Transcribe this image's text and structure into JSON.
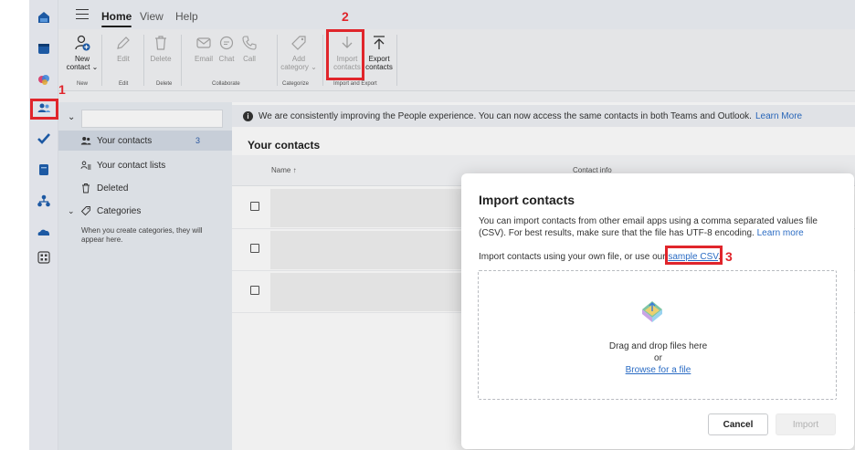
{
  "menu": {
    "tabs": [
      "Home",
      "View",
      "Help"
    ],
    "active": "Home"
  },
  "ribbon": {
    "buttons": [
      {
        "label1": "New",
        "label2": "contact ⌄",
        "icon": "person-add-icon"
      },
      {
        "label1": "Edit",
        "label2": "",
        "icon": "pencil-icon"
      },
      {
        "label1": "Delete",
        "label2": "",
        "icon": "trash-icon"
      },
      {
        "label1": "Email",
        "label2": "",
        "icon": "mail-icon"
      },
      {
        "label1": "Chat",
        "label2": "",
        "icon": "chat-icon"
      },
      {
        "label1": "Call",
        "label2": "",
        "icon": "phone-icon"
      },
      {
        "label1": "Add",
        "label2": "category ⌄",
        "icon": "tag-icon"
      },
      {
        "label1": "Import",
        "label2": "contacts",
        "icon": "arrow-down-icon"
      },
      {
        "label1": "Export",
        "label2": "contacts",
        "icon": "arrow-up-icon"
      }
    ],
    "groups": [
      "New",
      "Edit",
      "Delete",
      "Collaborate",
      "Categorize",
      "Import and Export"
    ]
  },
  "sidebar": {
    "items": [
      {
        "label": "Your contacts",
        "count": "3",
        "icon": "people-icon"
      },
      {
        "label": "Your contact lists",
        "icon": "people-list-icon"
      },
      {
        "label": "Deleted",
        "icon": "trash-icon"
      },
      {
        "label": "Categories",
        "icon": "tag-icon"
      }
    ],
    "categories_hint": "When you create categories, they will appear here."
  },
  "banner": {
    "text": "We are consistently improving the People experience. You can now access the same contacts in both Teams and Outlook.",
    "link": "Learn More"
  },
  "contacts": {
    "title": "Your contacts",
    "columns": [
      "Name ↑",
      "Contact info"
    ]
  },
  "dialog": {
    "title": "Import contacts",
    "description": "You can import contacts from other email apps using a comma separated values file (CSV). For best results, make sure that the file has UTF-8 encoding.",
    "description_link": "Learn more",
    "line_prefix": "Import contacts using your own file, or use our",
    "line_link": "sample CSV",
    "line_suffix": ".",
    "drop_text": "Drag and drop files here",
    "or_text": "or",
    "browse_link": "Browse for a file",
    "cancel": "Cancel",
    "import": "Import"
  },
  "annotations": {
    "n1": "1",
    "n2": "2",
    "n3": "3",
    "color": "#e0252b"
  }
}
